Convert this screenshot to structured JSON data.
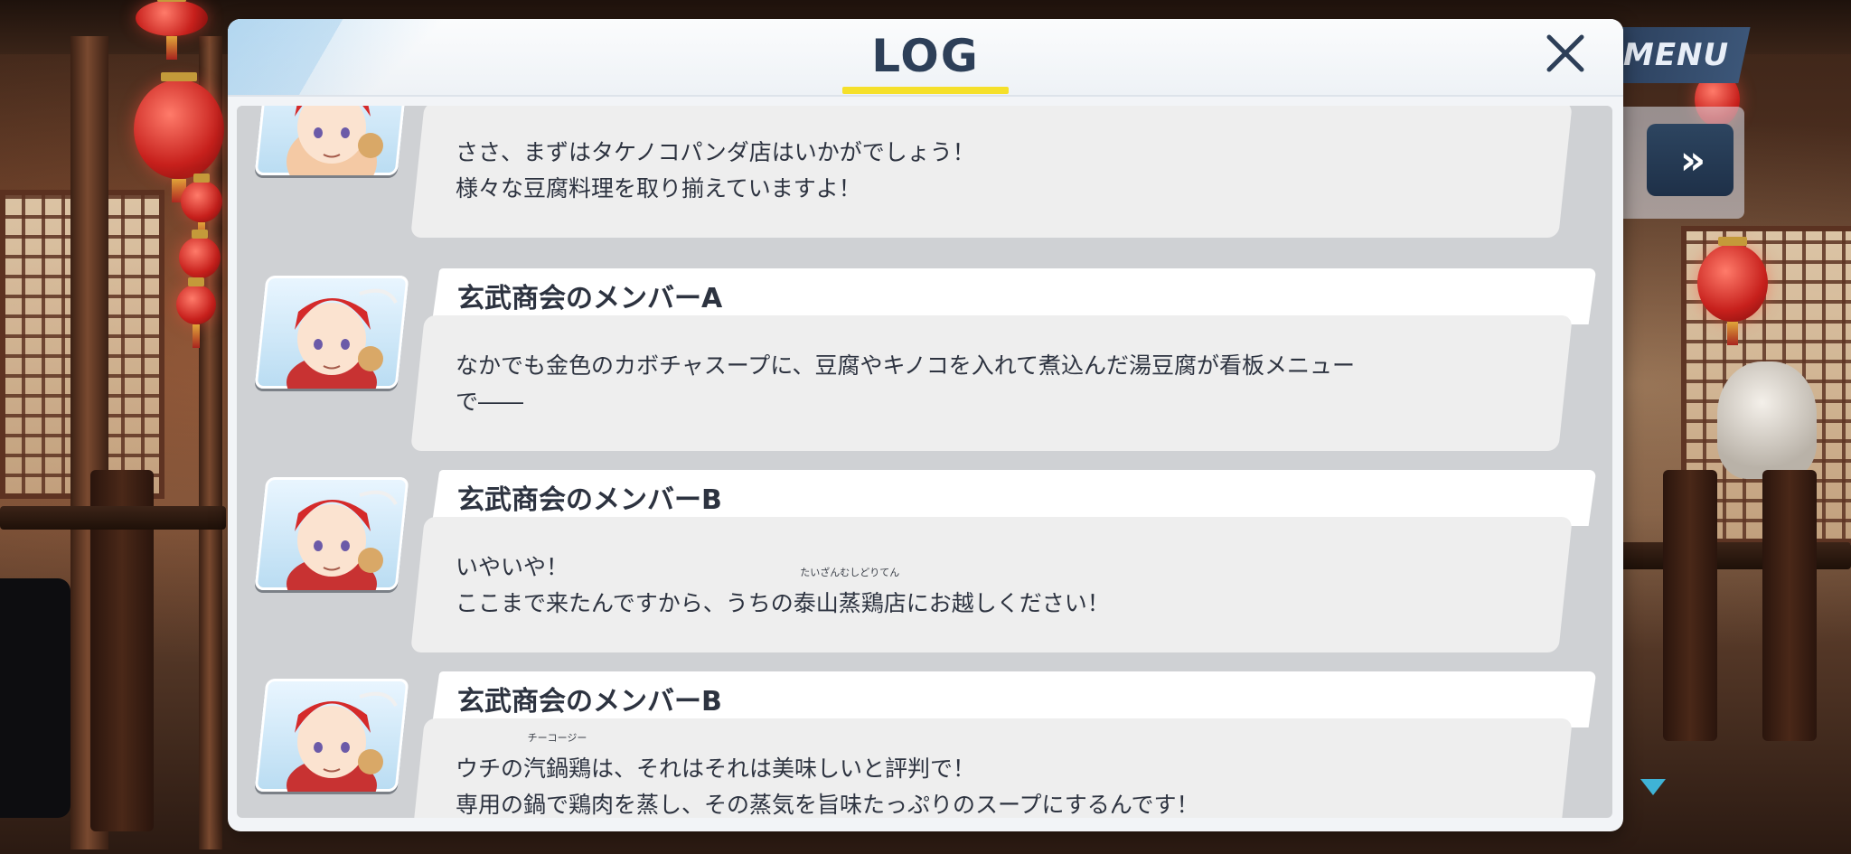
{
  "header": {
    "title": "LOG",
    "close_icon": "close-icon",
    "underline_color": "#f5e02a"
  },
  "background_ui": {
    "menu_label": "MENU",
    "fast_forward_icon": "fast-forward-icon",
    "fast_forward_glyph": "»",
    "scroll_down_icon": "triangle-down-icon"
  },
  "entries": [
    {
      "speaker": "",
      "line1": "ささ、まずはタケノコパンダ店はいかがでしょう！",
      "line2": "様々な豆腐料理を取り揃えていますよ！"
    },
    {
      "speaker": "玄武商会のメンバーA",
      "line1": "なかでも金色のカボチャスープに、豆腐やキノコを入れて煮込んだ湯豆腐が看板メニュー",
      "line2": "で――"
    },
    {
      "speaker": "玄武商会のメンバーB",
      "line1": "いやいや！",
      "line2_pre": "ここまで来たんですから、うちの",
      "line2_ruby_base": "泰山蒸鶏店",
      "line2_ruby_text": "たいざんむしどりてん",
      "line2_post": "にお越しください！"
    },
    {
      "speaker": "玄武商会のメンバーB",
      "line1_pre": "ウチの",
      "line1_ruby_base": "汽鍋鶏",
      "line1_ruby_text": "チーコージー",
      "line1_post": "は、それはそれは美味しいと評判で！",
      "line2": "専用の鍋で鶏肉を蒸し、その蒸気を旨味たっぷりのスープにするんです！"
    }
  ]
}
